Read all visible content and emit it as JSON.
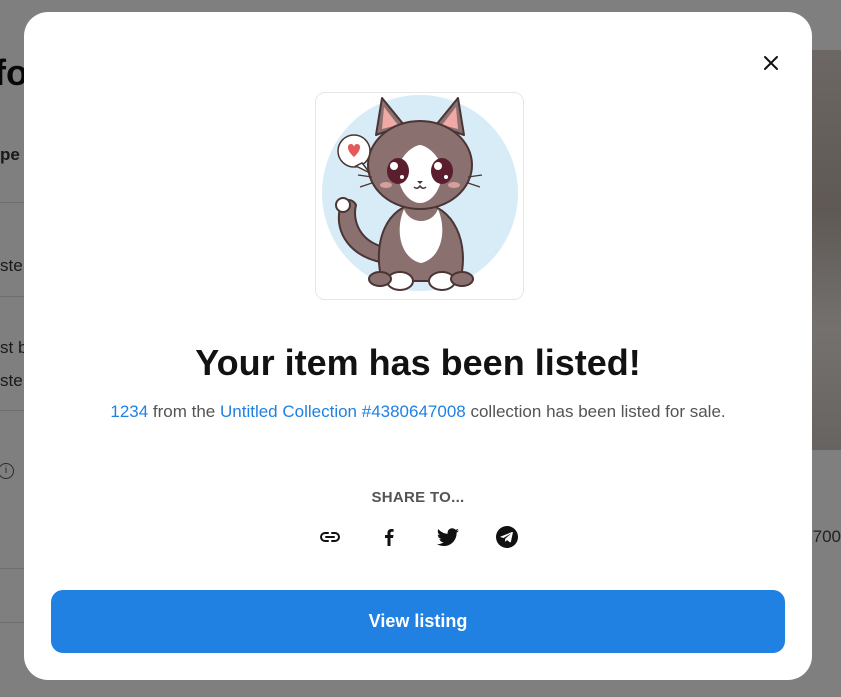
{
  "background": {
    "title_fragment": "fo",
    "label_1": "pe",
    "label_2": "ste",
    "label_3": "st b",
    "label_4": "ste",
    "number_fragment": "700"
  },
  "modal": {
    "close_icon": "close-icon",
    "image_alt": "cute cartoon kitten",
    "title": "Your item has been listed!",
    "description": {
      "item_name": "1234",
      "text_1": " from the ",
      "collection_name": "Untitled Collection #4380647008",
      "text_2": " collection has been listed for sale."
    },
    "share_label": "SHARE TO...",
    "share_icons": [
      "link-icon",
      "facebook-icon",
      "twitter-icon",
      "telegram-icon"
    ],
    "button_label": "View listing"
  },
  "colors": {
    "accent": "#2081e2",
    "title": "#121212",
    "body_text": "#545454"
  }
}
